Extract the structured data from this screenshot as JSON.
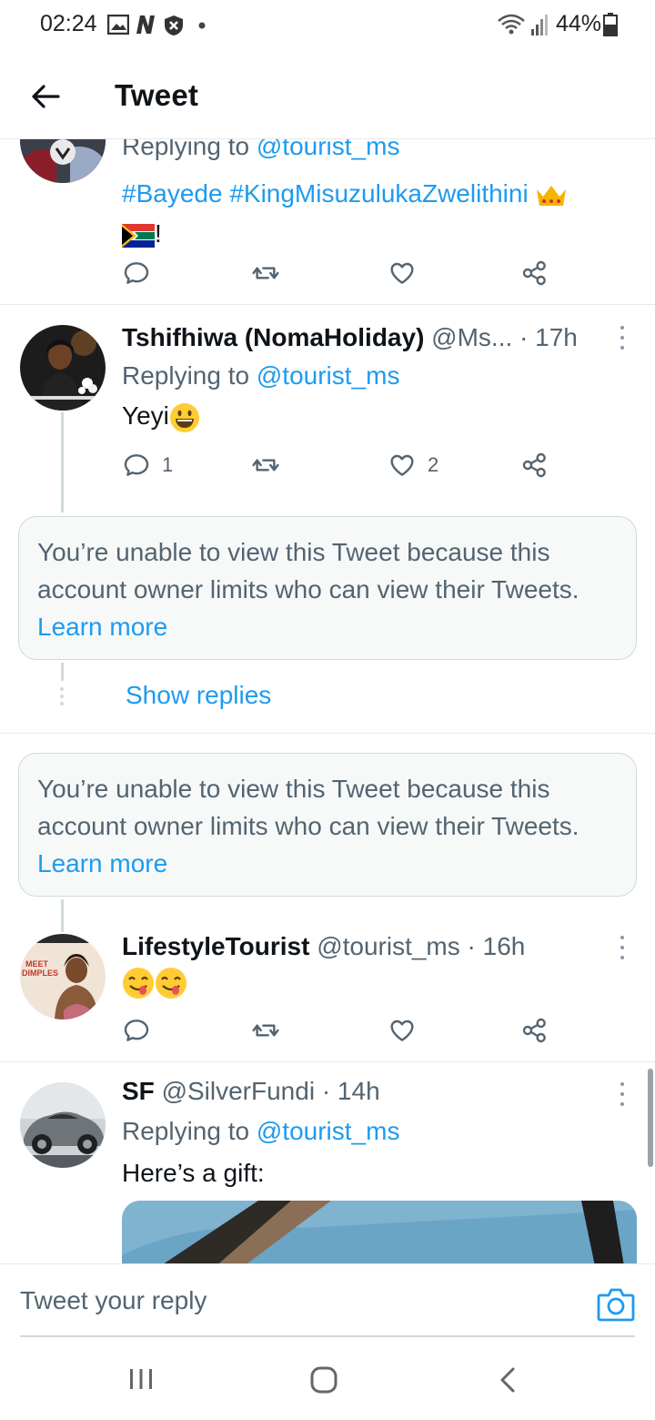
{
  "status_bar": {
    "time": "02:24",
    "battery": "44%"
  },
  "header": {
    "title": "Tweet"
  },
  "tweets": [
    {
      "reply_prefix": "Replying to ",
      "reply_handle": "@tourist_ms",
      "text": "#Bayede #KingMisuzulukaZwelithini",
      "text_tail": "!"
    },
    {
      "name": "Tshifhiwa (NomaHoliday)",
      "meta": "@Ms... · 17h",
      "reply_prefix": "Replying to ",
      "reply_handle": "@tourist_ms",
      "text": "Yeyi",
      "reply_count": "1",
      "like_count": "2"
    },
    {
      "name": "LifestyleTourist",
      "meta": "@tourist_ms · 16h"
    },
    {
      "name": "SF",
      "meta": "@SilverFundi · 14h",
      "reply_prefix": "Replying to ",
      "reply_handle": "@tourist_ms",
      "text": "Here’s a gift:"
    }
  ],
  "locked": {
    "text": "You’re unable to view this Tweet because this account owner limits who can view their Tweets. ",
    "learn_more": "Learn more"
  },
  "show_replies": "Show replies",
  "reply_bar": {
    "placeholder": "Tweet your reply"
  },
  "colors": {
    "accent": "#1d9bf0",
    "secondary_text": "#536471"
  },
  "icons": [
    "back-arrow-icon",
    "reply-icon",
    "retweet-icon",
    "like-icon",
    "share-icon",
    "more-icon",
    "camera-icon",
    "recents-icon",
    "home-icon",
    "nav-back-icon"
  ]
}
